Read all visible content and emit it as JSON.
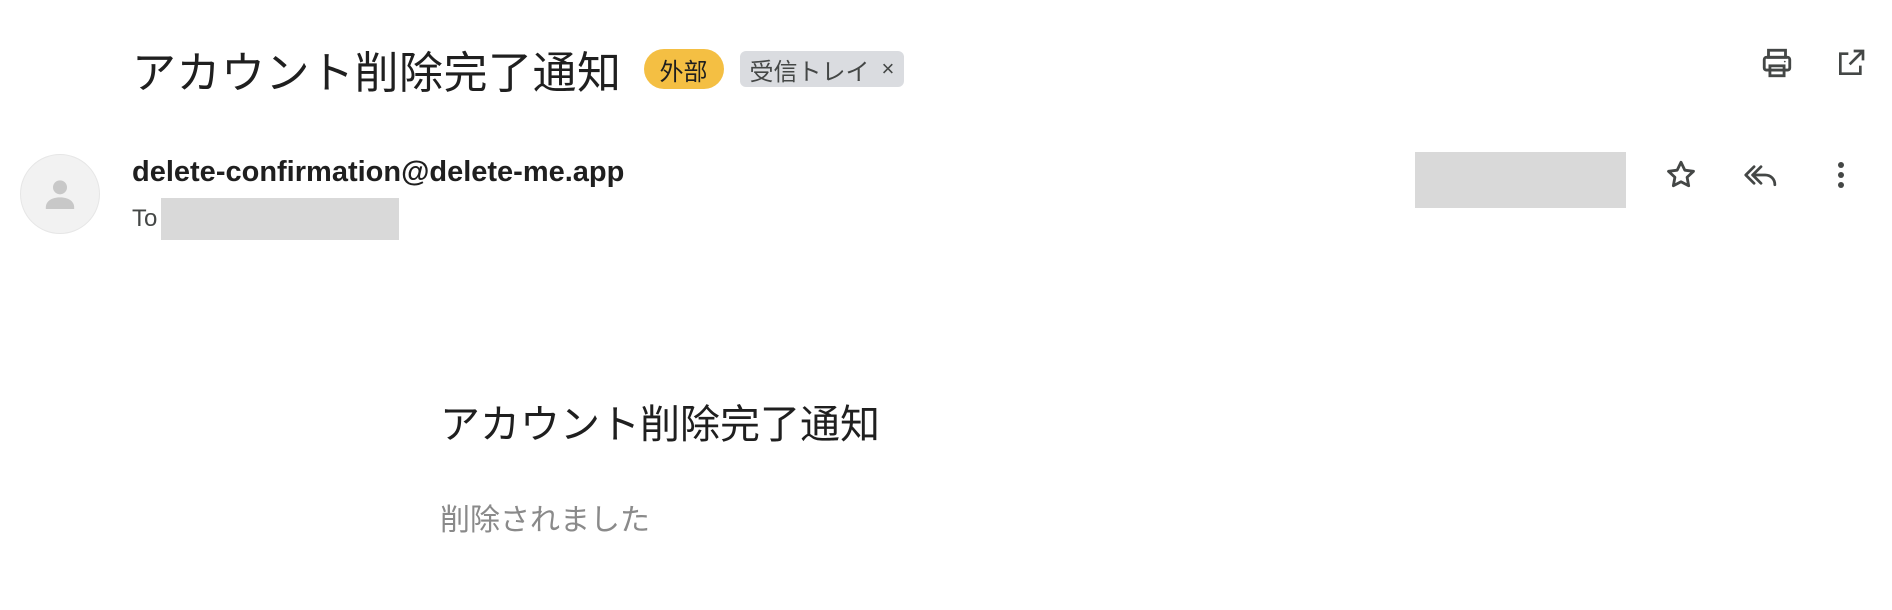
{
  "email": {
    "subject": "アカウント削除完了通知",
    "badges": {
      "external": "外部",
      "inbox_label": "受信トレイ",
      "inbox_close": "×"
    },
    "sender": "delete-confirmation@delete-me.app",
    "to_label": "To",
    "body": {
      "heading": "アカウント削除完了通知",
      "text": "削除されました"
    }
  },
  "icons": {
    "print": "print-icon",
    "open_new_window": "open-in-new-window-icon",
    "star": "star-icon",
    "reply_all": "reply-all-icon",
    "more": "more-vertical-icon",
    "avatar": "person-icon"
  },
  "colors": {
    "external_badge": "#f4bf43",
    "inbox_label_bg": "#dadce0",
    "redaction": "#d9d9d9",
    "icon": "#444746"
  }
}
